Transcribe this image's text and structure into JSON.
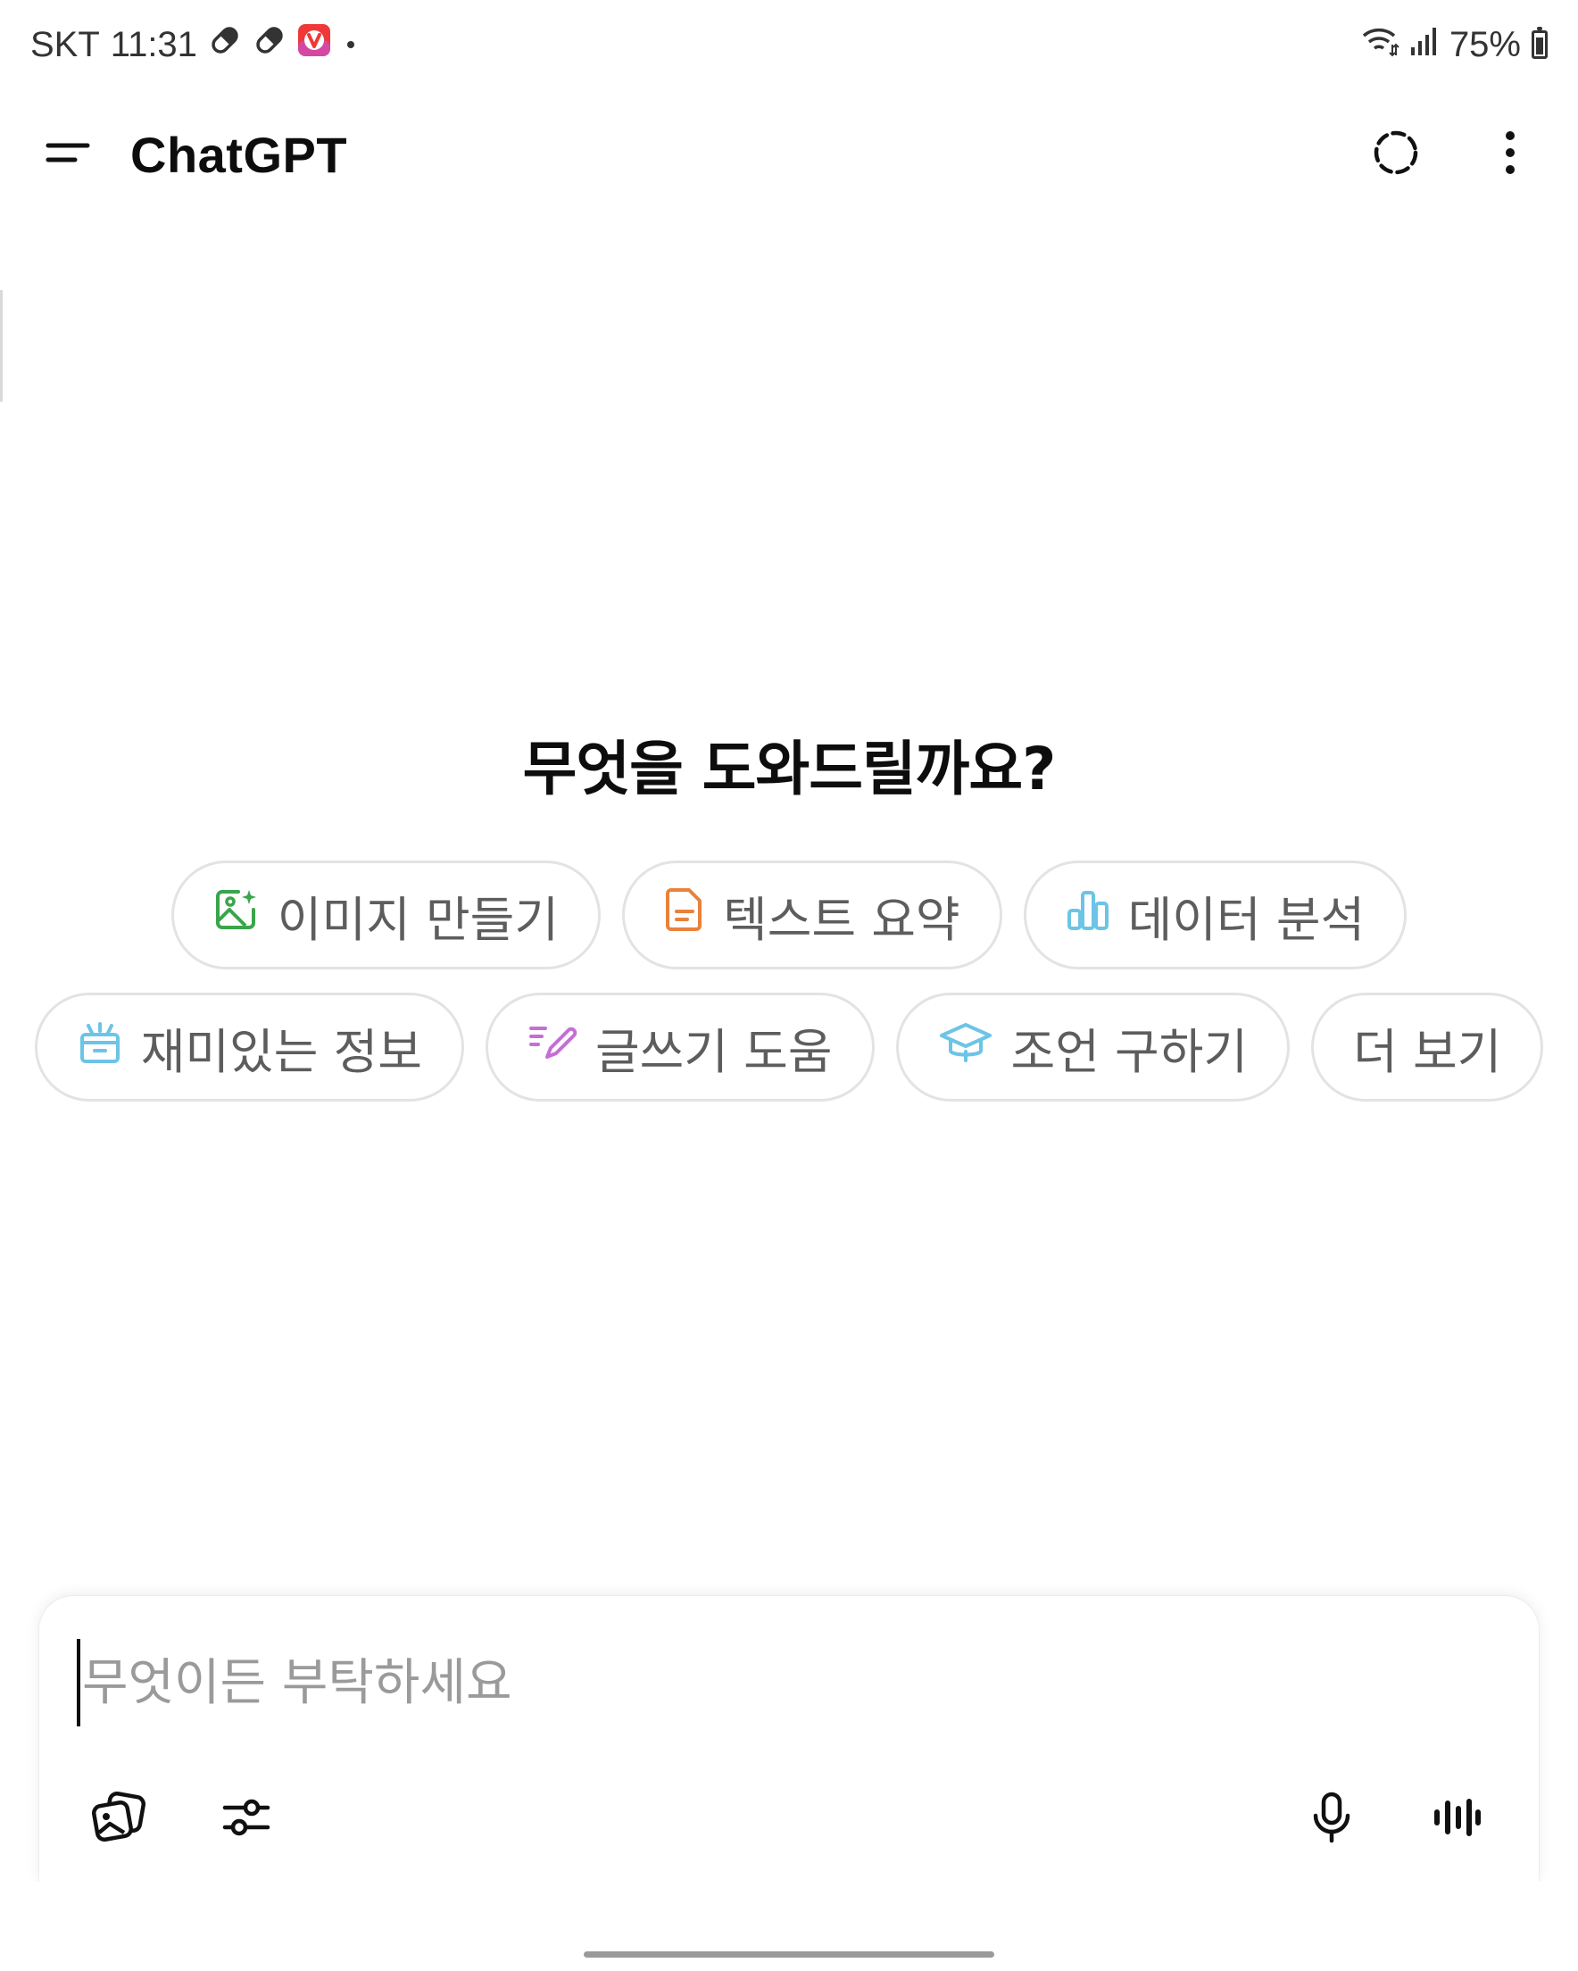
{
  "status_bar": {
    "carrier": "SKT",
    "time": "11:31",
    "notification_icons": [
      "pill-icon",
      "pill-icon",
      "vivaldi-app-icon"
    ],
    "battery": "75%",
    "battery_level": 0.75
  },
  "header": {
    "title": "ChatGPT",
    "menu_icon": "menu-icon",
    "temporary_chat_icon": "dashed-circle-icon",
    "more_icon": "more-vertical-icon"
  },
  "main": {
    "greeting": "무엇을 도와드릴까요?",
    "suggestions_row1": [
      {
        "label": "이미지 만들기",
        "icon": "image-create-icon",
        "color": "#3aa54a"
      },
      {
        "label": "텍스트 요약",
        "icon": "document-icon",
        "color": "#e8823c"
      },
      {
        "label": "데이터 분석",
        "icon": "bar-chart-icon",
        "color": "#6cc4e6"
      }
    ],
    "suggestions_row2": [
      {
        "label": "재미있는 정보",
        "icon": "gift-box-icon",
        "color": "#6cc4e6"
      },
      {
        "label": "글쓰기 도움",
        "icon": "pen-icon",
        "color": "#c46ed6"
      },
      {
        "label": "조언 구하기",
        "icon": "graduation-cap-icon",
        "color": "#6cc4e6"
      },
      {
        "label": "더 보기",
        "icon": "",
        "color": ""
      }
    ]
  },
  "composer": {
    "placeholder": "무엇이든 부탁하세요",
    "value": "",
    "attach_icon": "photos-icon",
    "tools_icon": "sliders-icon",
    "mic_icon": "microphone-icon",
    "voice_icon": "voice-waveform-icon"
  }
}
